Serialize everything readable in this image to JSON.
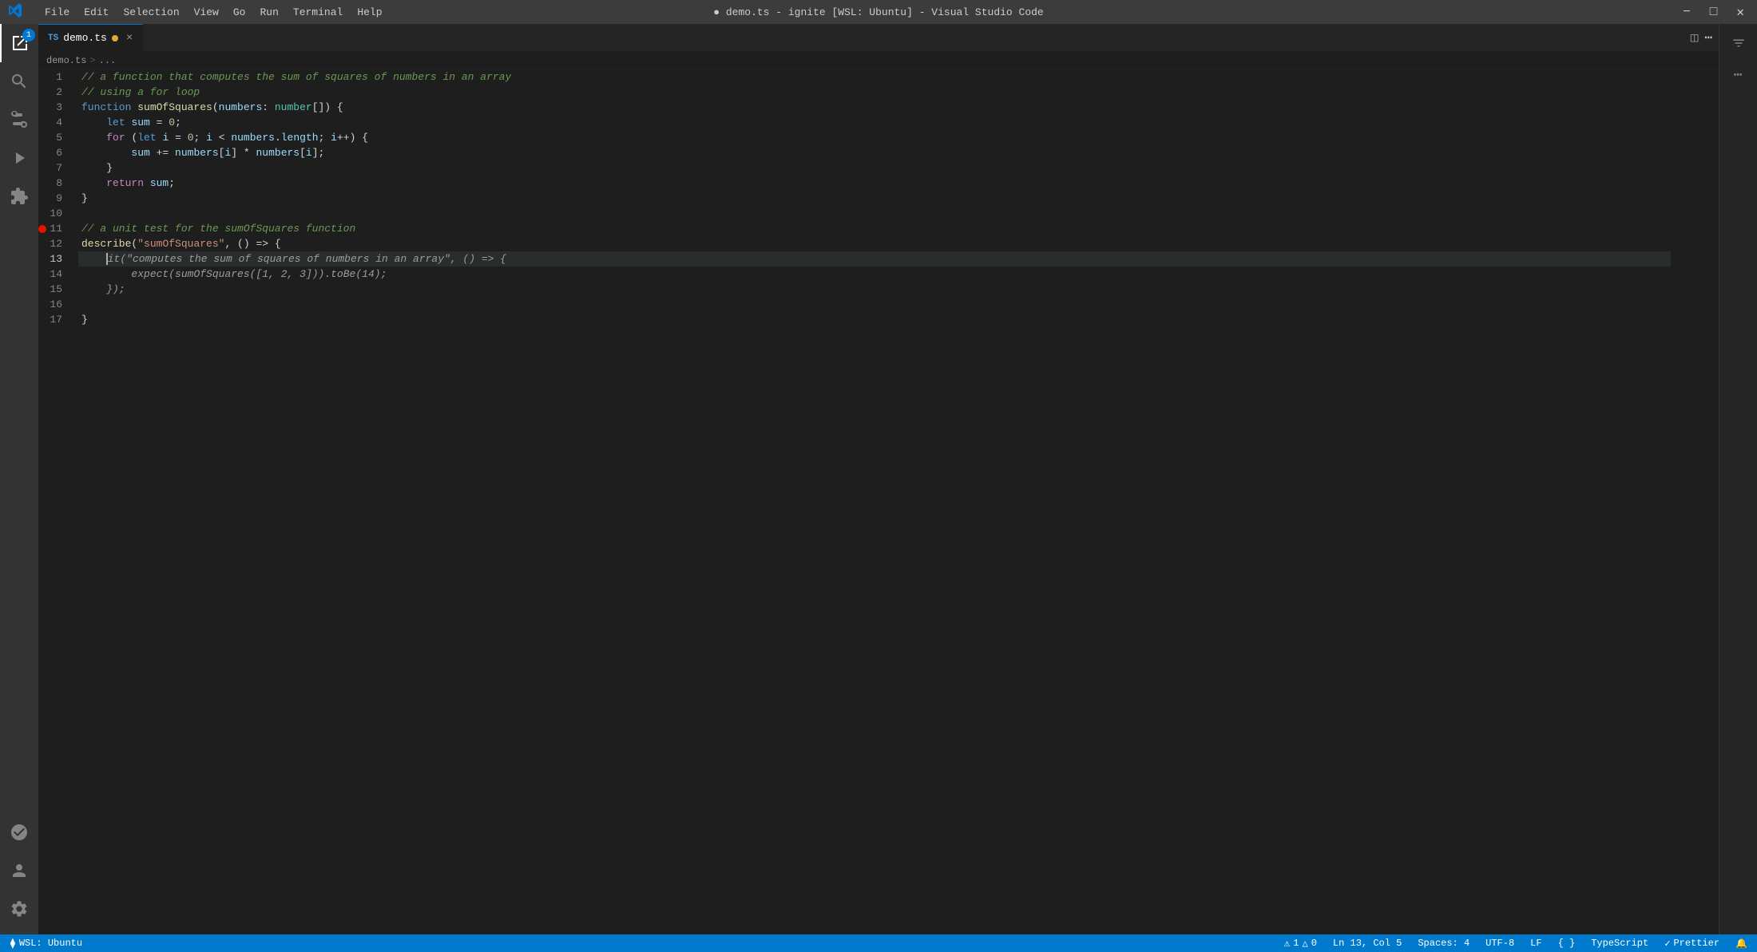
{
  "titleBar": {
    "appName": "demo.ts - ignite [WSL: Ubuntu] - Visual Studio Code",
    "menu": [
      "File",
      "Edit",
      "Selection",
      "View",
      "Go",
      "Run",
      "Terminal",
      "Help"
    ],
    "windowControls": [
      "_",
      "□",
      "×"
    ]
  },
  "tabs": [
    {
      "id": "demo-ts",
      "prefix": "TS",
      "name": "demo.ts",
      "modified": true,
      "active": true,
      "badgeCount": "1"
    }
  ],
  "breadcrumb": {
    "parts": [
      "demo.ts",
      ">",
      "..."
    ]
  },
  "statusBar": {
    "wsl": "WSL: Ubuntu",
    "errors": "1",
    "warnings": "0",
    "position": "Ln 13, Col 5",
    "spaces": "Spaces: 4",
    "encoding": "UTF-8",
    "lineEnding": "LF",
    "braces": "{ }",
    "language": "TypeScript",
    "prettier": "Prettier"
  },
  "codeLines": [
    {
      "num": 1,
      "content": "comment",
      "text": "// a function that computes the sum of squares of numbers in an array"
    },
    {
      "num": 2,
      "content": "comment",
      "text": "// using a for loop"
    },
    {
      "num": 3,
      "content": "function-def",
      "text": "function sumOfSquares(numbers: number[]) {"
    },
    {
      "num": 4,
      "content": "let-decl",
      "text": "    let sum = 0;"
    },
    {
      "num": 5,
      "content": "for-loop",
      "text": "    for (let i = 0; i < numbers.length; i++) {"
    },
    {
      "num": 6,
      "content": "sum-assign",
      "text": "        sum += numbers[i] * numbers[i];"
    },
    {
      "num": 7,
      "content": "closing-brace",
      "text": "    }"
    },
    {
      "num": 8,
      "content": "return-stmt",
      "text": "    return sum;"
    },
    {
      "num": 9,
      "content": "closing-brace2",
      "text": "}"
    },
    {
      "num": 10,
      "content": "empty",
      "text": ""
    },
    {
      "num": 11,
      "content": "comment2",
      "text": "// a unit test for the sumOfSquares function",
      "hasBreakpoint": true
    },
    {
      "num": 12,
      "content": "describe",
      "text": "describe(\"sumOfSquares\", () => {"
    },
    {
      "num": 13,
      "content": "it-block",
      "text": "    it(\"computes the sum of squares of numbers in an array\", () => {",
      "active": true
    },
    {
      "num": 14,
      "content": "expect",
      "text": "        expect(sumOfSquares([1, 2, 3])).toBe(14);"
    },
    {
      "num": 15,
      "content": "closing-cb",
      "text": "    });"
    },
    {
      "num": 16,
      "content": "empty2",
      "text": ""
    },
    {
      "num": 17,
      "content": "closing-describe",
      "text": "}"
    }
  ]
}
